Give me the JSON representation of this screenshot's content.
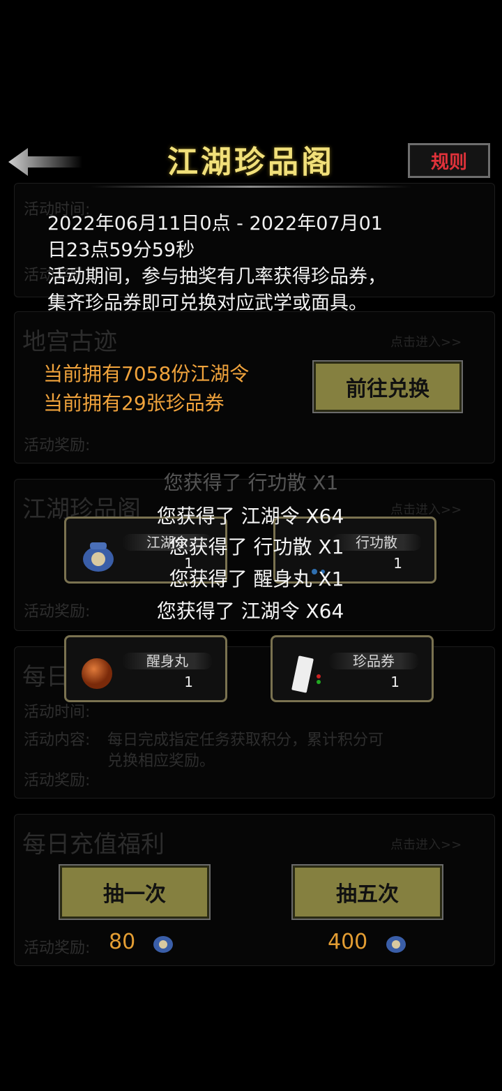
{
  "header": {
    "title": "江湖珍品阁",
    "rule_label": "规则"
  },
  "info": {
    "date_line1": "2022年06月11日0点 - 2022年07月01",
    "date_line2": "日23点59分59秒",
    "desc_line1": "活动期间，参与抽奖有几率获得珍品券，",
    "desc_line2": "集齐珍品券即可兑换对应武学或面具。"
  },
  "holdings": {
    "tokens": "当前拥有7058份江湖令",
    "tickets": "当前拥有29张珍品券"
  },
  "exchange_label": "前往兑换",
  "rewards": [
    {
      "name": "江湖令",
      "count": "1"
    },
    {
      "name": "行功散",
      "count": "1"
    },
    {
      "name": "醒身丸",
      "count": "1"
    },
    {
      "name": "珍品券",
      "count": "1"
    }
  ],
  "messages": {
    "faded": "您获得了 行功散 X1",
    "m1": "您获得了 江湖令 X64",
    "m2": "您获得了 行功散 X1",
    "m3": "您获得了 醒身丸 X1",
    "m4": "您获得了 江湖令 X64"
  },
  "draw": {
    "once_label": "抽一次",
    "five_label": "抽五次",
    "once_cost": "80",
    "five_cost": "400"
  },
  "background": {
    "label_time": "活动时间:",
    "label_content": "活动内容:",
    "label_reward": "活动奖励:",
    "title_dungeon": "地宫古迹",
    "title_jianghu": "江湖珍品阁",
    "title_daily": "每日",
    "title_recharge": "每日充值福利",
    "enter_label": "点击进入>>",
    "daily_desc1": "每日完成指定任务获取积分，累计积分可",
    "daily_desc2": "兑换相应奖励。"
  },
  "colors": {
    "accent_gold": "#f1e07a",
    "orange": "#f0a33c",
    "button_olive": "#858040",
    "rule_red": "#e0323a"
  }
}
